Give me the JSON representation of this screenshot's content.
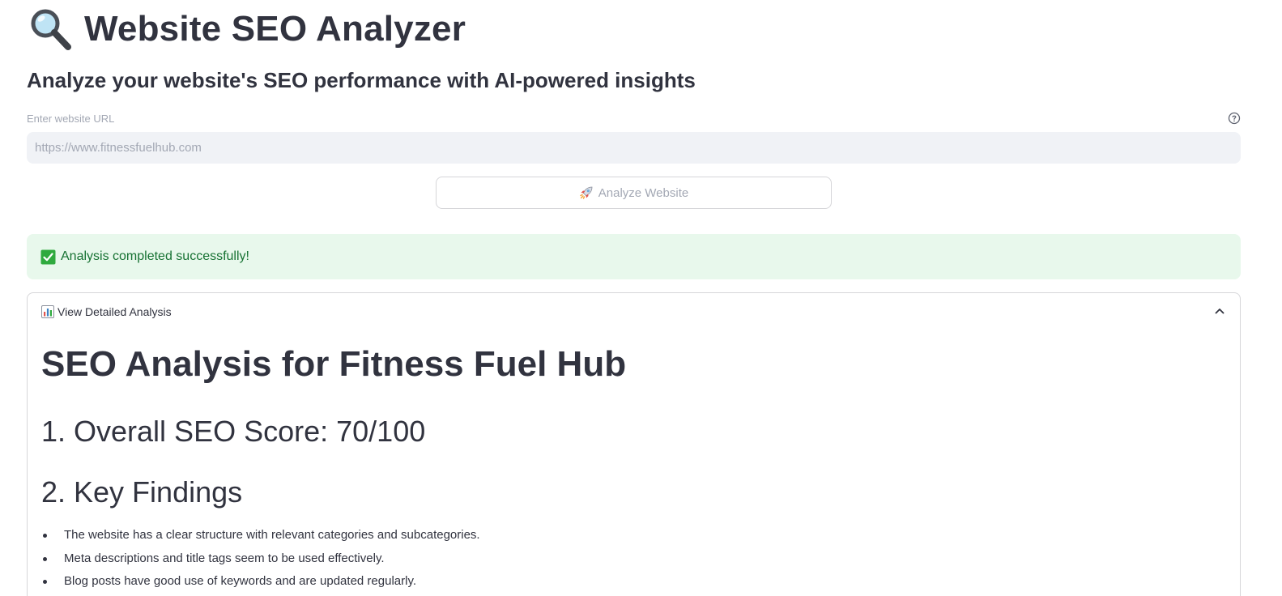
{
  "app": {
    "title": "Website SEO Analyzer",
    "title_icon": "magnifying-glass-icon",
    "subtitle": "Analyze your website's SEO performance with AI-powered insights"
  },
  "form": {
    "url_label": "Enter website URL",
    "url_placeholder": "https://www.fitnessfuelhub.com",
    "url_value": "",
    "help_icon": "question-circle-icon",
    "analyze_button_label": "Analyze Website",
    "analyze_button_icon": "rocket-icon"
  },
  "status": {
    "icon": "checkmark-icon",
    "message": "Analysis completed successfully!",
    "color": "#177233",
    "background": "#e8f8ec"
  },
  "expander": {
    "icon": "bar-chart-icon",
    "label": "View Detailed Analysis",
    "expanded": true
  },
  "report": {
    "title": "SEO Analysis for Fitness Fuel Hub",
    "score_heading": "1. Overall SEO Score: 70/100",
    "findings_heading": "2. Key Findings",
    "findings": [
      "The website has a clear structure with relevant categories and subcategories.",
      "Meta descriptions and title tags seem to be used effectively.",
      "Blog posts have good use of keywords and are updated regularly."
    ]
  }
}
